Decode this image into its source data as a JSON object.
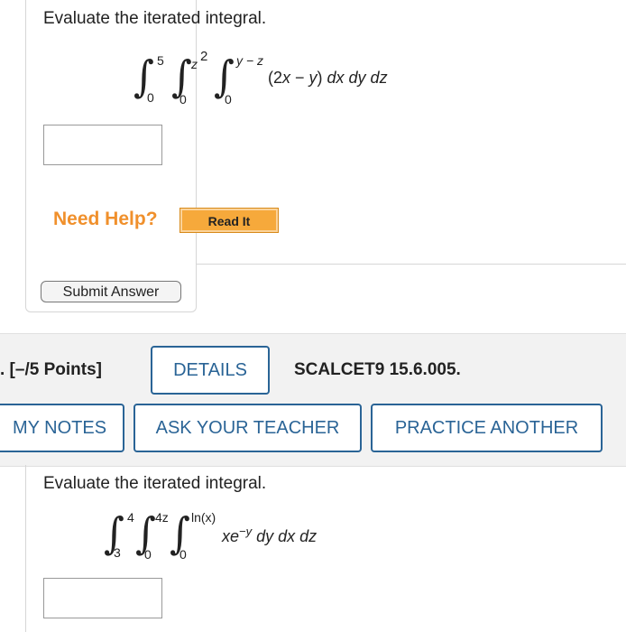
{
  "question1": {
    "prompt": "Evaluate the iterated integral.",
    "integral": {
      "symbol": "∫",
      "outer_upper": "5",
      "outer_lower": "0",
      "middle_upper": "z",
      "middle_upper_exp": "2",
      "middle_lower": "0",
      "inner_upper": "y − z",
      "inner_lower": "0",
      "integrand_prefix": "(2",
      "integrand_x": "x",
      "integrand_minus": " − ",
      "integrand_y": "y",
      "integrand_suffix": ") ",
      "differentials": "dx dy dz"
    },
    "answer_value": "",
    "need_help_label": "Need Help?",
    "read_it_label": "Read It",
    "submit_label": "Submit Answer"
  },
  "question2": {
    "points_label": ". [–/5 Points]",
    "details_label": "DETAILS",
    "code": "SCALCET9 15.6.005.",
    "my_notes_label": "MY NOTES",
    "ask_teacher_label": "ASK YOUR TEACHER",
    "practice_another_label": "PRACTICE ANOTHER",
    "prompt": "Evaluate the iterated integral.",
    "integral": {
      "symbol": "∫",
      "outer_upper": "4",
      "outer_lower": "3",
      "middle_upper": "4z",
      "middle_lower": "0",
      "inner_upper": "ln(x)",
      "inner_lower": "0",
      "integrand_base": "xe",
      "integrand_exp": "−y",
      "differentials": "dy dx dz"
    },
    "answer_value": ""
  },
  "colors": {
    "accent": "#2a6496",
    "need_help": "#f0902c",
    "read_it_bg": "#f6a93b",
    "band_bg": "#f2f2f2"
  }
}
